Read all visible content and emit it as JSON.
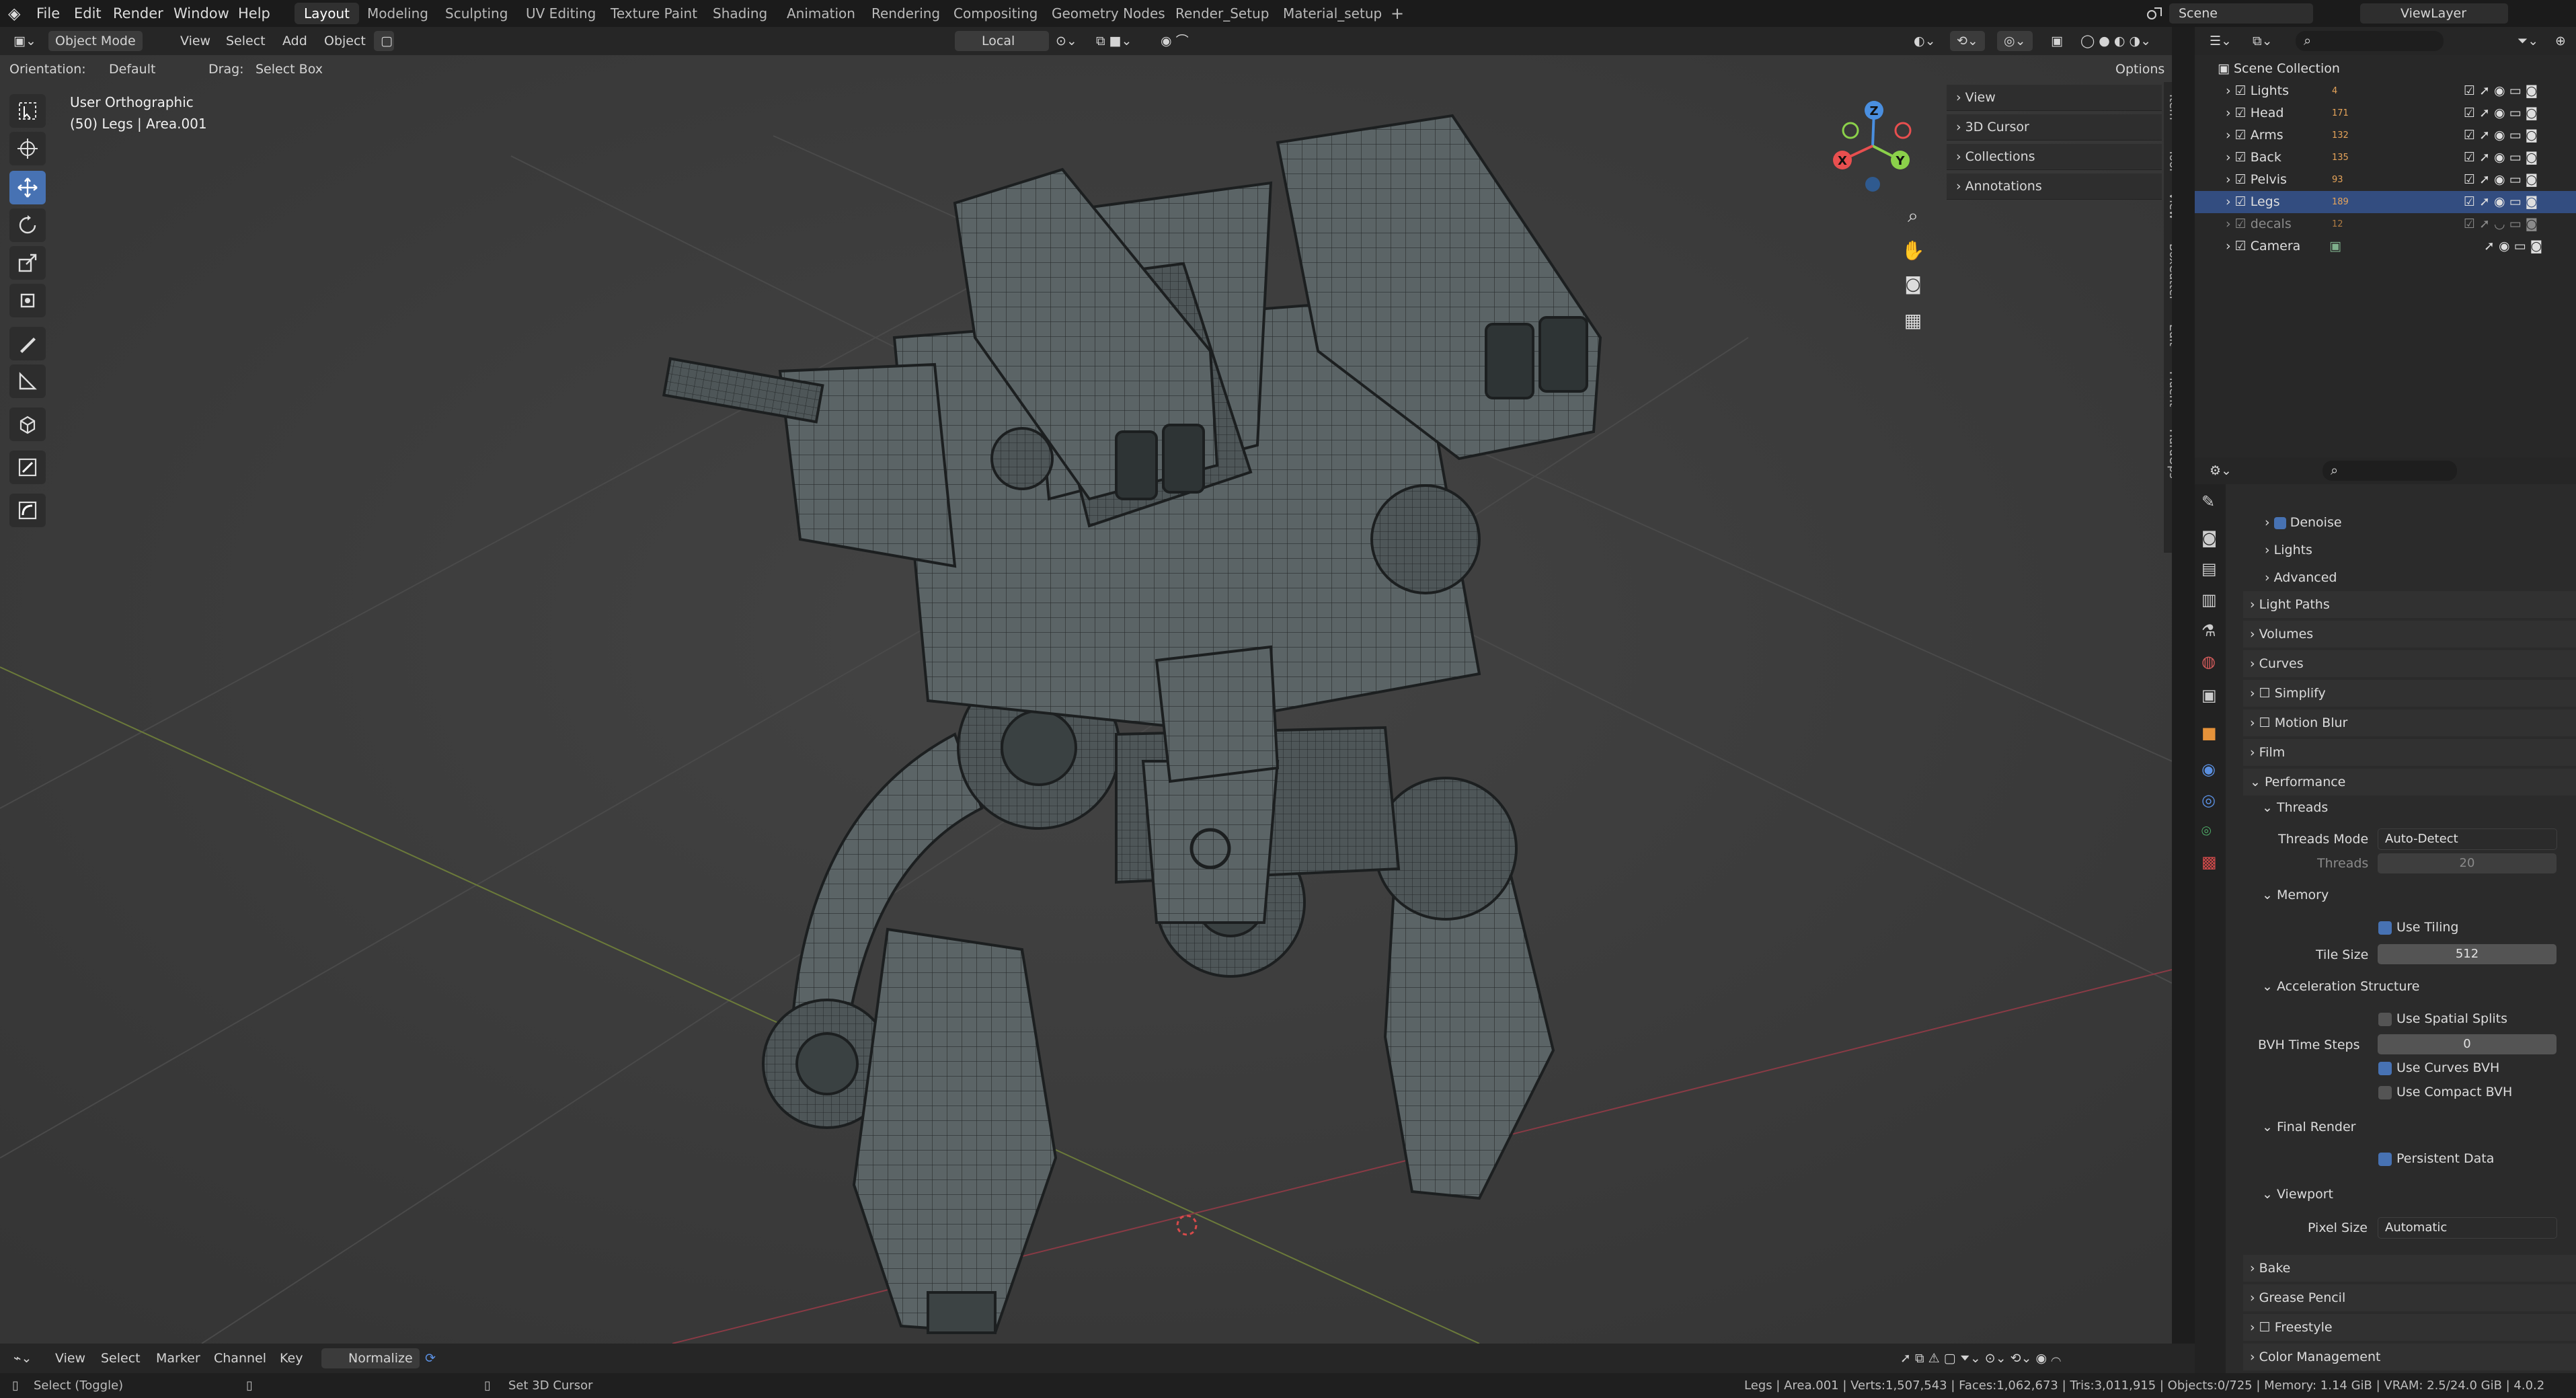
{
  "menu": [
    "File",
    "Edit",
    "Render",
    "Window",
    "Help"
  ],
  "workspaces": [
    "Layout",
    "Modeling",
    "Sculpting",
    "UV Editing",
    "Texture Paint",
    "Shading",
    "Animation",
    "Rendering",
    "Compositing",
    "Geometry Nodes",
    "Render_Setup",
    "Material_setup"
  ],
  "active_workspace": "Layout",
  "scene_name": "Scene",
  "view_layer": "ViewLayer",
  "header": {
    "mode": "Object Mode",
    "view": "View",
    "select": "Select",
    "add": "Add",
    "object": "Object",
    "transform_orientation": "Local",
    "orientation_label": "Orientation:",
    "orientation_value": "Default",
    "drag_label": "Drag:",
    "drag_value": "Select Box",
    "options": "Options"
  },
  "viewport": {
    "view_name": "User Orthographic",
    "object_info": "(50) Legs | Area.001",
    "gizmo_axes": [
      "Z",
      "Y",
      "X"
    ]
  },
  "npanel": {
    "sections": [
      "View",
      "3D Cursor",
      "Collections",
      "Annotations"
    ],
    "tabs": [
      "Item",
      "Tool",
      "View",
      "BoxCutter",
      "Edit",
      "Fluent",
      "HardOps"
    ]
  },
  "outliner": {
    "root": "Scene Collection",
    "items": [
      {
        "name": "Lights",
        "count": "4"
      },
      {
        "name": "Head",
        "count": "171"
      },
      {
        "name": "Arms",
        "count": "132"
      },
      {
        "name": "Back",
        "count": "135"
      },
      {
        "name": "Pelvis",
        "count": "93"
      },
      {
        "name": "Legs",
        "count": "189"
      },
      {
        "name": "decals",
        "count": "12"
      },
      {
        "name": "Camera",
        "count": ""
      }
    ],
    "selected": "Legs"
  },
  "properties": {
    "sampling_sub": [
      "Denoise",
      "Lights",
      "Advanced"
    ],
    "panels": [
      "Light Paths",
      "Volumes",
      "Curves",
      "Simplify",
      "Motion Blur",
      "Film",
      "Performance"
    ],
    "threads_title": "Threads",
    "threads_mode_label": "Threads Mode",
    "threads_mode_value": "Auto-Detect",
    "threads_label": "Threads",
    "threads_value": "20",
    "memory_title": "Memory",
    "use_tiling": "Use Tiling",
    "tile_size_label": "Tile Size",
    "tile_size_value": "512",
    "accel_title": "Acceleration Structure",
    "use_spatial_splits": "Use Spatial Splits",
    "bvh_label": "BVH Time Steps",
    "bvh_value": "0",
    "use_curves_bvh": "Use Curves BVH",
    "use_compact_bvh": "Use Compact BVH",
    "final_render_title": "Final Render",
    "persistent_data": "Persistent Data",
    "viewport_title": "Viewport",
    "pixel_size_label": "Pixel Size",
    "pixel_size_value": "Automatic",
    "bottom_panels": [
      "Bake",
      "Grease Pencil",
      "Freestyle",
      "Color Management"
    ]
  },
  "timeline": {
    "items": [
      "View",
      "Select",
      "Marker",
      "Channel",
      "Key"
    ],
    "normalize": "Normalize"
  },
  "status": {
    "left": "Select (Toggle)",
    "middle": "Set 3D Cursor",
    "right": "Legs | Area.001 | Verts:1,507,543 | Faces:1,062,673 | Tris:3,011,915 | Objects:0/725 | Memory: 1.14 GiB | VRAM: 2.5/24.0 GiB | 4.0.2"
  },
  "colors": {
    "accent": "#4772b3",
    "x_axis": "#e84f4f",
    "y_axis": "#8bd14a",
    "z_axis": "#4a8fe0"
  }
}
